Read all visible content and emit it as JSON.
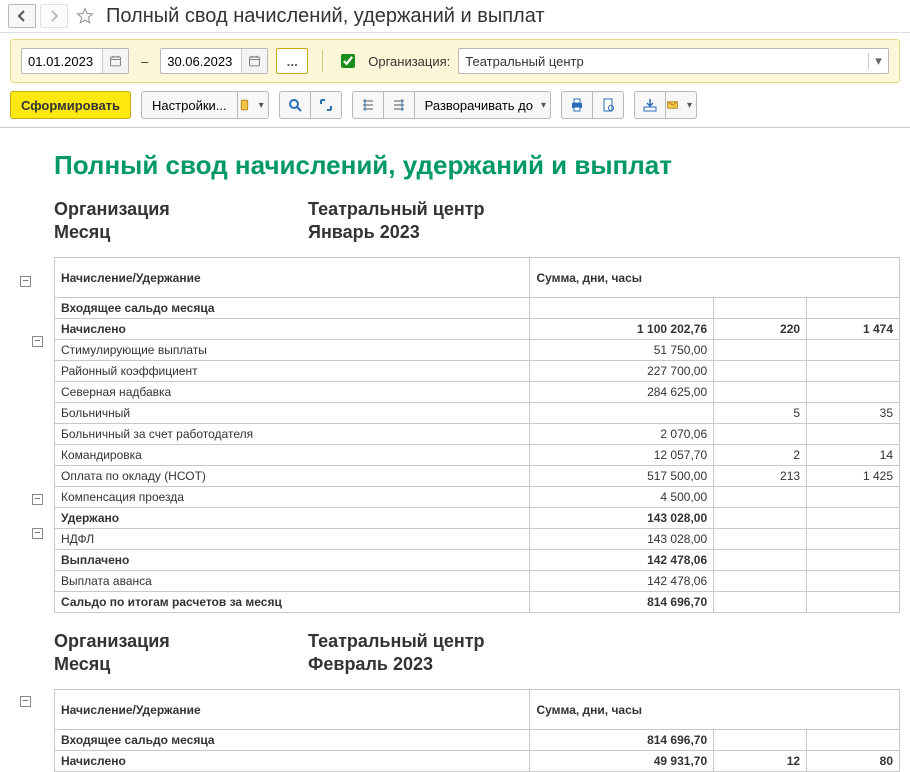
{
  "header": {
    "title": "Полный свод начислений, удержаний и выплат"
  },
  "filter": {
    "date_from": "01.01.2023",
    "date_to": "30.06.2023",
    "dots": "...",
    "org_label": "Организация:",
    "org_value": "Театральный центр"
  },
  "toolbar": {
    "generate": "Сформировать",
    "settings": "Настройки...",
    "expand": "Разворачивать до"
  },
  "report": {
    "title": "Полный свод начислений, удержаний и выплат",
    "meta_labels": {
      "org": "Организация",
      "month": "Месяц"
    },
    "header_col1": "Начисление/Удержание",
    "header_col2": "Сумма, дни, часы",
    "sections": [
      {
        "org": "Театральный центр",
        "month": "Январь 2023",
        "rows": [
          {
            "bold": true,
            "name": "Входящее сальдо месяца"
          },
          {
            "bold": true,
            "name": "Начислено",
            "v1": "1 100 202,76",
            "v2": "220",
            "v3": "1 474"
          },
          {
            "name": "Стимулирующие выплаты",
            "v1": "51 750,00"
          },
          {
            "name": "Районный коэффициент",
            "v1": "227 700,00"
          },
          {
            "name": "Северная надбавка",
            "v1": "284 625,00"
          },
          {
            "name": "Больничный",
            "v2": "5",
            "v3": "35"
          },
          {
            "name": "Больничный за счет работодателя",
            "v1": "2 070,06"
          },
          {
            "name": "Командировка",
            "v1": "12 057,70",
            "v2": "2",
            "v3": "14"
          },
          {
            "name": "Оплата по окладу (НСОТ)",
            "v1": "517 500,00",
            "v2": "213",
            "v3": "1 425"
          },
          {
            "name": "Компенсация проезда",
            "v1": "4 500,00"
          },
          {
            "bold": true,
            "name": "Удержано",
            "v1": "143 028,00"
          },
          {
            "name": "НДФЛ",
            "v1": "143 028,00"
          },
          {
            "bold": true,
            "name": "Выплачено",
            "v1": "142 478,06"
          },
          {
            "name": "Выплата аванса",
            "v1": "142 478,06"
          },
          {
            "bold": true,
            "name": "Сальдо по итогам расчетов за месяц",
            "v1": "814 696,70"
          }
        ]
      },
      {
        "org": "Театральный центр",
        "month": "Февраль 2023",
        "rows": [
          {
            "bold": true,
            "name": "Входящее сальдо месяца",
            "v1": "814 696,70"
          },
          {
            "bold": true,
            "name": "Начислено",
            "v1": "49 931,70",
            "v2": "12",
            "v3": "80"
          }
        ]
      }
    ]
  }
}
